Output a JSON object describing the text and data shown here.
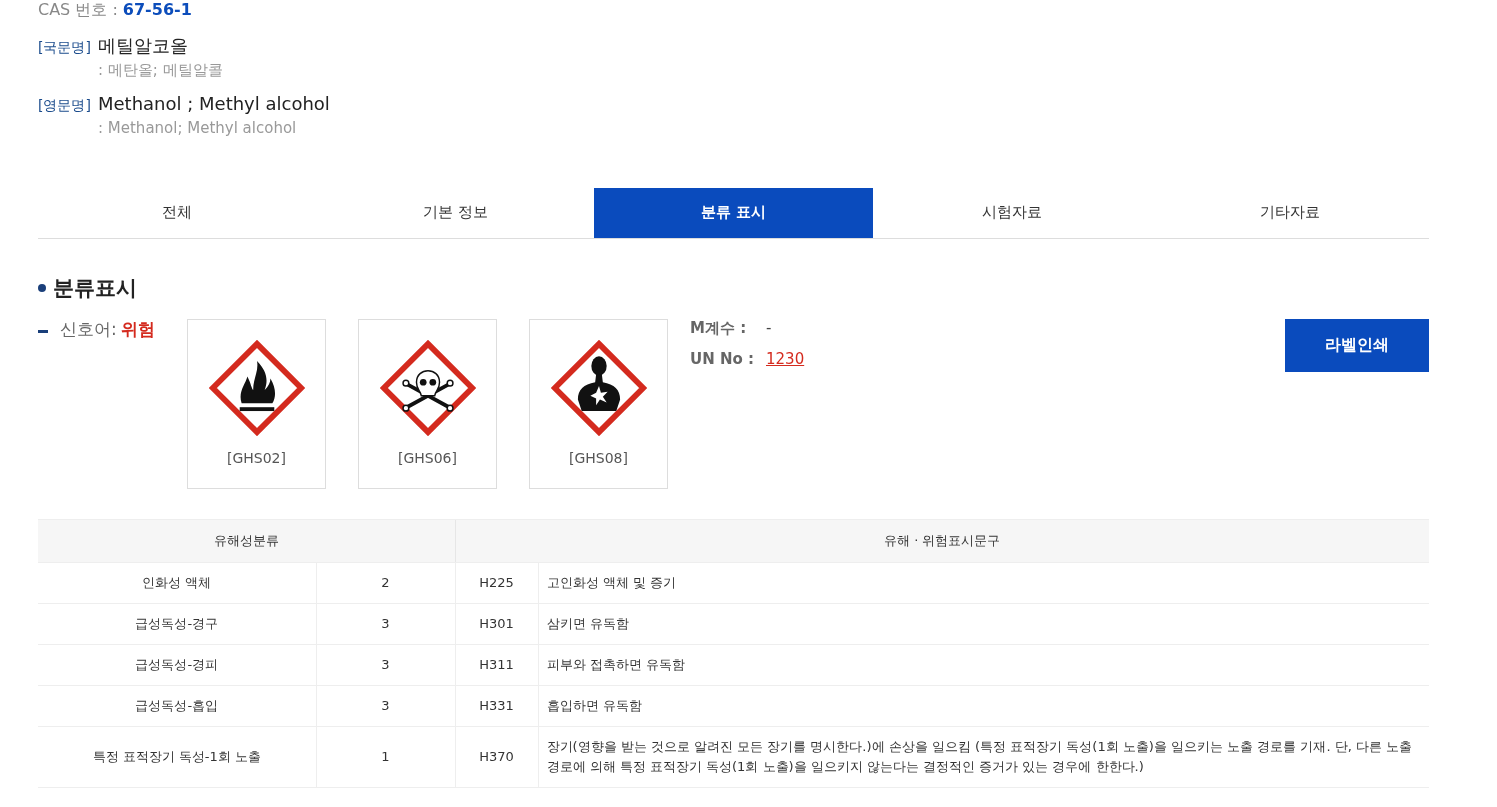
{
  "cas": {
    "label": "CAS 번호 :",
    "value": "67-56-1"
  },
  "names": [
    {
      "tag": "[국문명]",
      "name": "메틸알코올",
      "synonyms": ": 메탄올; 메틸알콜"
    },
    {
      "tag": "[영문명]",
      "name": "Methanol ; Methyl alcohol",
      "synonyms": ": Methanol; Methyl alcohol"
    }
  ],
  "tabs": [
    {
      "label": "전체",
      "selected": false
    },
    {
      "label": "기본 정보",
      "selected": false
    },
    {
      "label": "분류 표시",
      "selected": true
    },
    {
      "label": "시험자료",
      "selected": false
    },
    {
      "label": "기타자료",
      "selected": false
    }
  ],
  "section_title": "분류표시",
  "signal_word": {
    "label": "신호어:",
    "value": "위험"
  },
  "pictograms": [
    {
      "kind": "flame",
      "code": "[GHS02]"
    },
    {
      "kind": "skull",
      "code": "[GHS06]"
    },
    {
      "kind": "health",
      "code": "[GHS08]"
    }
  ],
  "m_factor": {
    "label": "M계수 :",
    "value": "-"
  },
  "un_no": {
    "label": "UN No :",
    "value": "1230"
  },
  "print_button": "라벨인쇄",
  "table": {
    "columns": [
      "유해성분류",
      "유해 · 위험표시문구"
    ],
    "rows": [
      {
        "class": "인화성 액체",
        "category": "2",
        "code": "H225",
        "statement": "고인화성 액체 및 증기"
      },
      {
        "class": "급성독성-경구",
        "category": "3",
        "code": "H301",
        "statement": "삼키면 유독함"
      },
      {
        "class": "급성독성-경피",
        "category": "3",
        "code": "H311",
        "statement": "피부와 접촉하면 유독함"
      },
      {
        "class": "급성독성-흡입",
        "category": "3",
        "code": "H331",
        "statement": "흡입하면 유독함"
      },
      {
        "class": "특정 표적장기 독성-1회 노출",
        "category": "1",
        "code": "H370",
        "statement": "장기(영향을 받는 것으로 알려진 모든 장기를 명시한다.)에 손상을 일으킴 (특정 표적장기 독성(1회 노출)을 일으키는 노출 경로를 기재. 단, 다른 노출경로에 의해 특정 표적장기 독성(1회 노출)을 일으키지 않는다는 결정적인 증거가 있는 경우에 한한다.)"
      }
    ]
  }
}
